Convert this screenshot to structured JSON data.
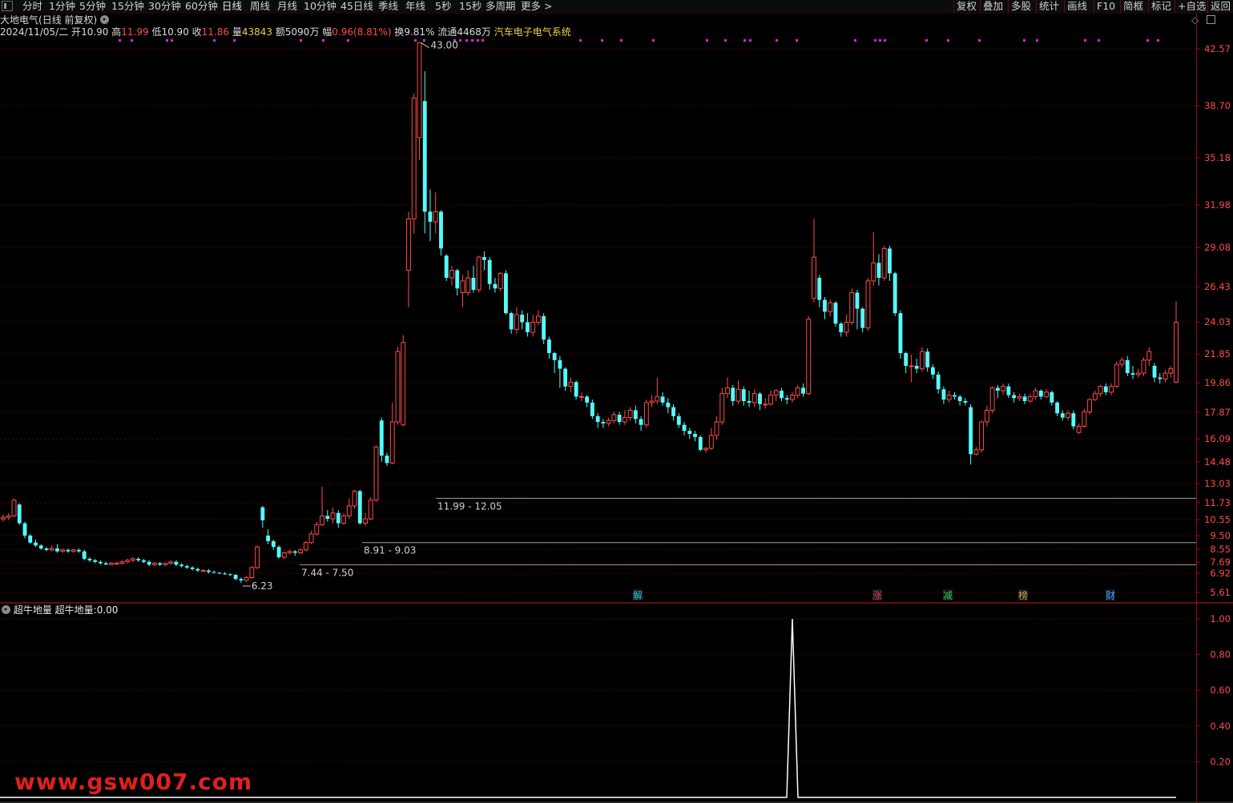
{
  "toolbar": {
    "timeframes": [
      "分时",
      "1分钟",
      "5分钟",
      "15分钟",
      "30分钟",
      "60分钟",
      "日线",
      "周线",
      "月线",
      "10分钟",
      "45日线",
      "季线",
      "年线",
      "5秒",
      "15秒",
      "多周期",
      "更多 >"
    ],
    "active": "日线",
    "right_buttons": [
      "复权",
      "叠加",
      "多股",
      "统计",
      "画线",
      "F10",
      "简框",
      "标记",
      "+自选",
      "返回"
    ]
  },
  "title": {
    "name": "大地电气",
    "mode": "(日线 前复权)"
  },
  "info": {
    "date": "2024/11/05/二",
    "open_label": "开",
    "open": "10.90",
    "high_label": "高",
    "high": "11.99",
    "low_label": "低",
    "low": "10.90",
    "close_label": "收",
    "close": "11.86",
    "vol_label": "量",
    "vol": "43843",
    "amt_label": "额",
    "amt": "5090万",
    "chg_label": "幅",
    "chg": "0.96(8.81%)",
    "turn_label": "换",
    "turn": "9.81%",
    "float_label": "流通",
    "float": "4468万",
    "sector": "汽车电子电气系统"
  },
  "price_axis": [
    "42.57",
    "38.70",
    "35.18",
    "31.98",
    "29.08",
    "26.43",
    "24.03",
    "21.85",
    "19.86",
    "17.87",
    "16.09",
    "14.48",
    "13.03",
    "11.73",
    "10.55",
    "9.50",
    "8.55",
    "7.69",
    "6.92",
    "5.61"
  ],
  "annotations": {
    "peak": "43.00",
    "bottom": "6.23",
    "band1": "11.99 - 12.05",
    "band2": "8.91 - 9.03",
    "band3": "7.44 - 7.50"
  },
  "event_markers": [
    {
      "label": "解",
      "color": "#2fc8c8"
    },
    {
      "label": "涨",
      "color": "#e04040"
    },
    {
      "label": "减",
      "color": "#3cc83c"
    },
    {
      "label": "榜",
      "color": "#d8a040"
    },
    {
      "label": "财",
      "color": "#4aa0ff"
    }
  ],
  "indicator": {
    "name": "超牛地量",
    "value_label": "超牛地量:",
    "value": "0.00",
    "axis": [
      "1.00",
      "0.80",
      "0.60",
      "0.40",
      "0.20"
    ]
  },
  "watermark": "www.gsw007.com",
  "colors": {
    "up": "#ff4b4b",
    "down": "#54fcfc",
    "grid": "#5a0000",
    "axis": "#8a1010"
  }
}
